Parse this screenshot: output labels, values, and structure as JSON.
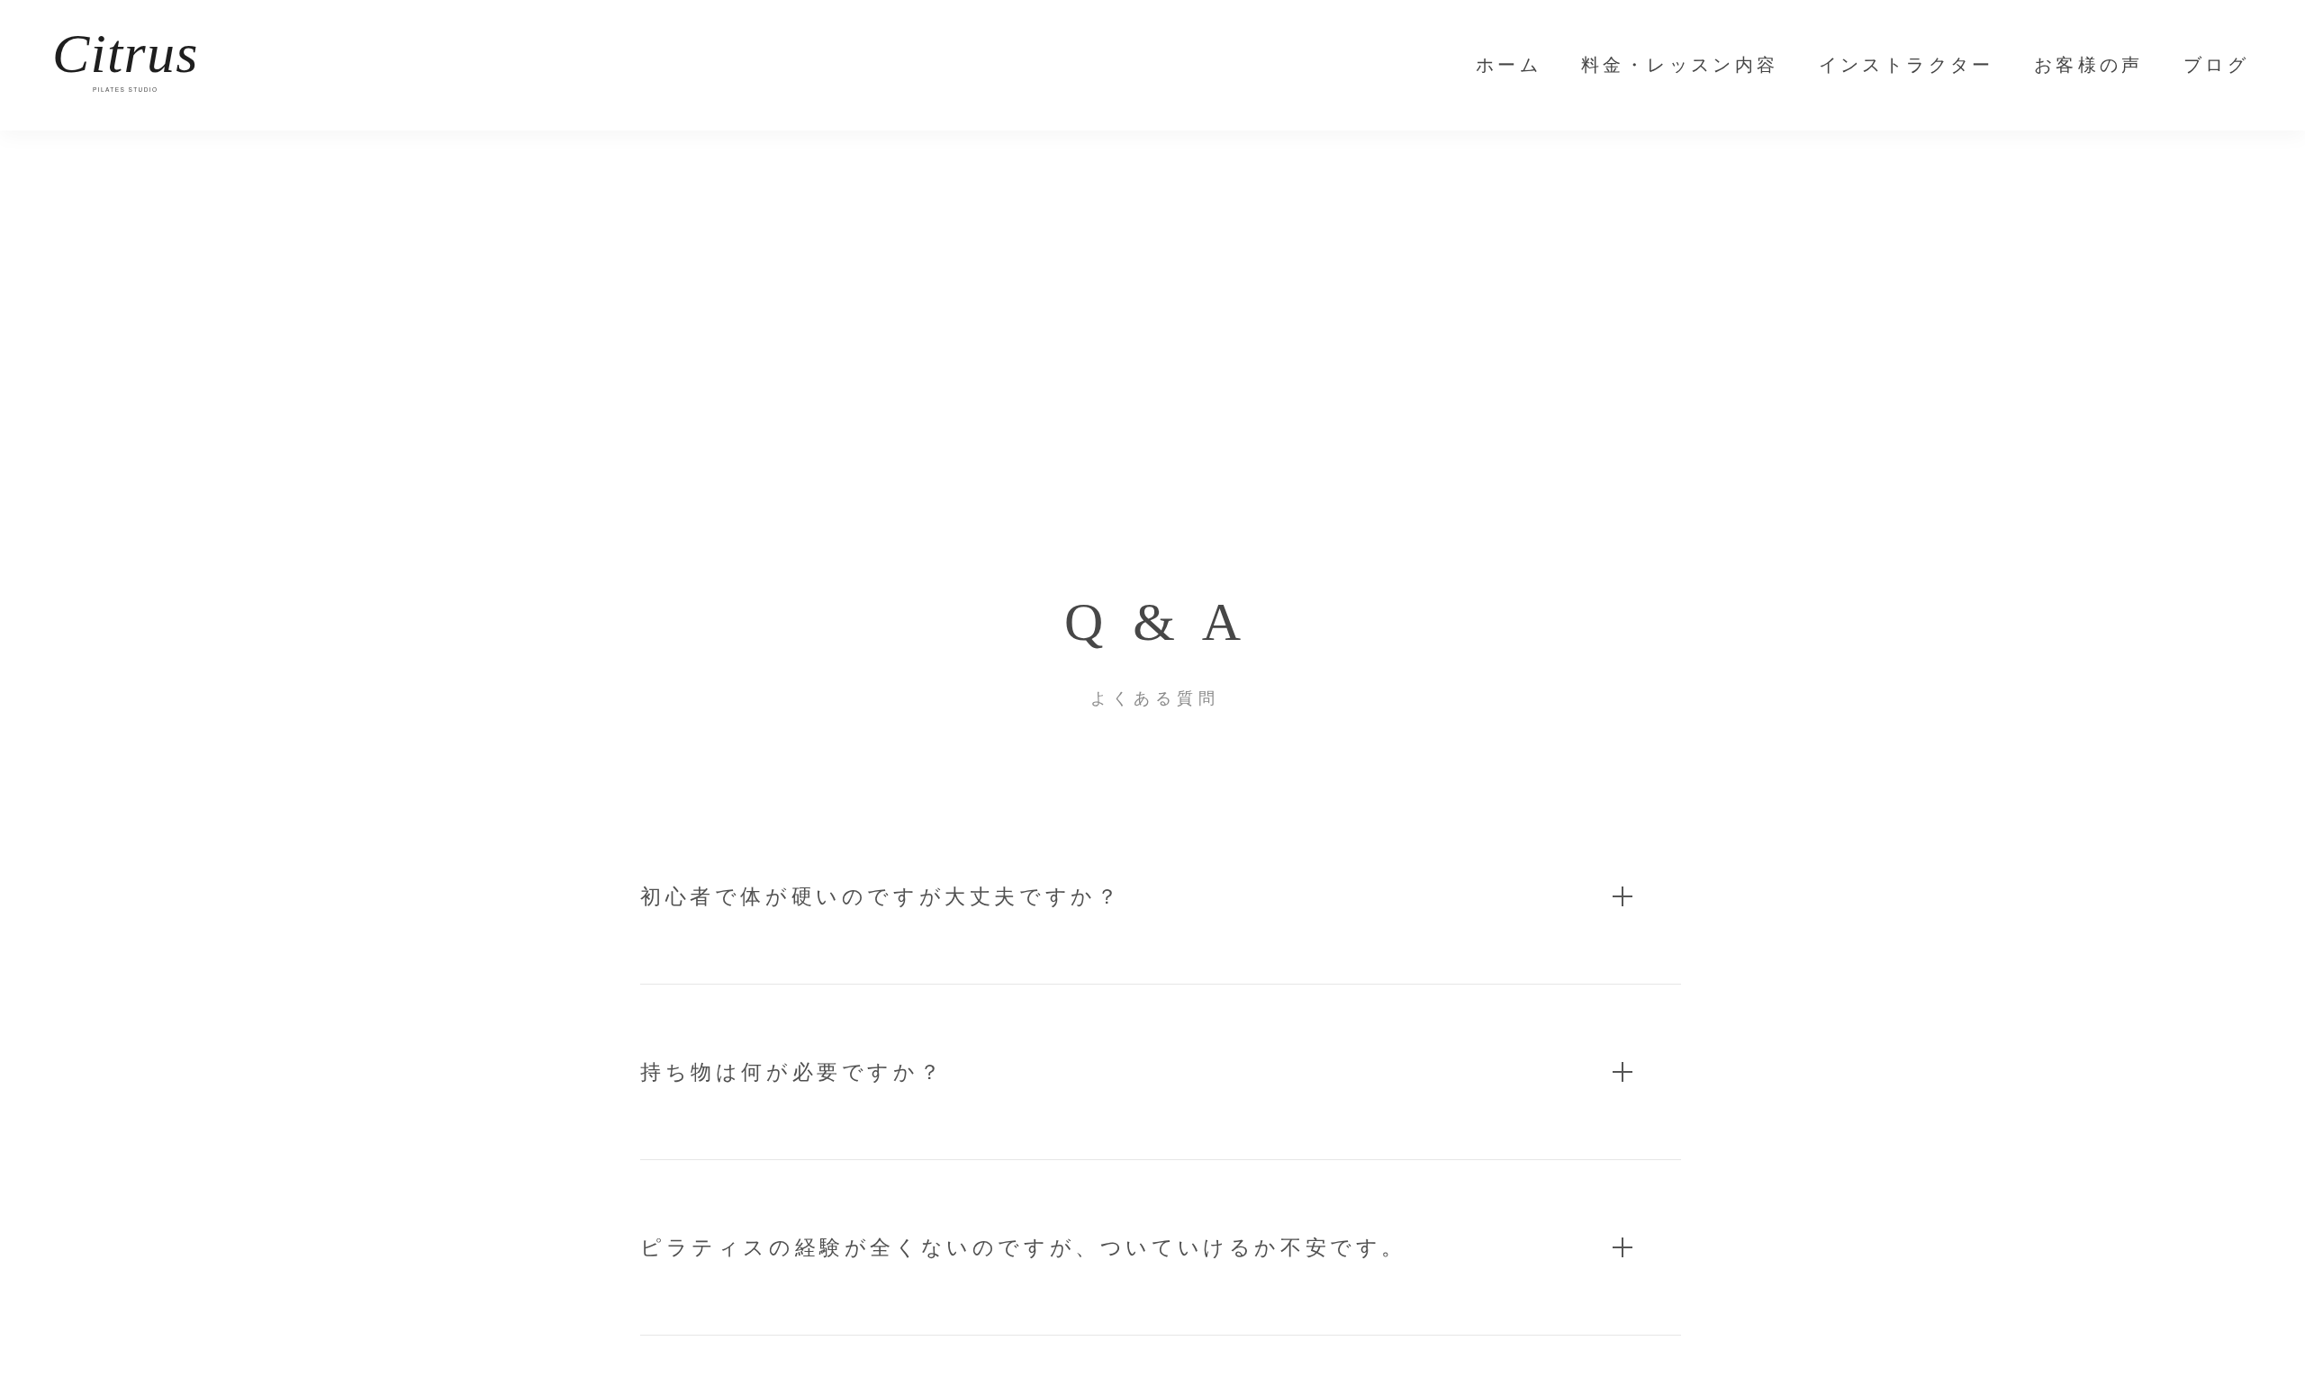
{
  "header": {
    "logo": {
      "script": "Citrus",
      "tagline": "PILATES STUDIO"
    },
    "nav": [
      {
        "label": "ホーム"
      },
      {
        "label": "料金・レッスン内容"
      },
      {
        "label": "インストラクター"
      },
      {
        "label": "お客様の声"
      },
      {
        "label": "ブログ"
      }
    ]
  },
  "section": {
    "title": "Q & A",
    "subtitle": "よくある質問",
    "faq": [
      {
        "question": "初心者で体が硬いのですが大丈夫ですか？",
        "expanded": false
      },
      {
        "question": "持ち物は何が必要ですか？",
        "expanded": false
      },
      {
        "question": "ピラティスの経験が全くないのですが、ついていけるか不安です。",
        "expanded": false
      }
    ]
  }
}
